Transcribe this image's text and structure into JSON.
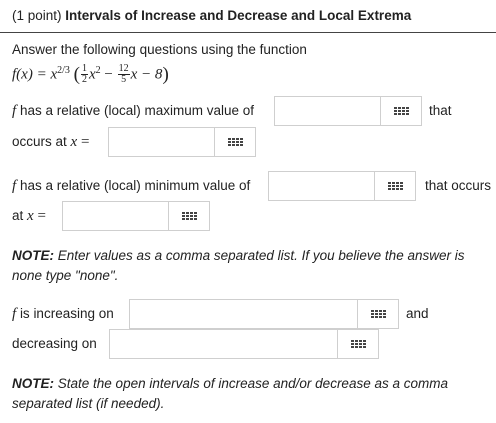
{
  "header": {
    "points": "(1 point)",
    "title": "Intervals of Increase and Decrease and Local Extrema"
  },
  "intro": {
    "text": "Answer the following questions using the function",
    "function_lhs": "f(x) = x",
    "exponent": "2/3",
    "frac1_num": "1",
    "frac1_den": "2",
    "x2": "x",
    "x2_exp": "2",
    "minus1": "−",
    "frac2_num": "12",
    "frac2_den": "5",
    "tail": "x − 8"
  },
  "q_max": {
    "f": "f",
    "prompt": "has a relative (local) maximum value of",
    "after": "that",
    "line2_prefix": "occurs at",
    "xvar": "x",
    "eq": "=",
    "value_answer": "",
    "location_answer": ""
  },
  "q_min": {
    "f": "f",
    "prompt": "has a relative (local) minimum value of",
    "after": "that occurs",
    "line2_prefix": "at",
    "xvar": "x",
    "eq": "=",
    "value_answer": "",
    "location_answer": ""
  },
  "note1": {
    "label": "NOTE:",
    "text": "Enter values as a comma separated list. If you believe the answer is",
    "text2": "none type \"none\"."
  },
  "q_intervals": {
    "f": "f",
    "increasing_label": "is increasing on",
    "and": "and",
    "decreasing_label": "decreasing on",
    "increasing_answer": "",
    "decreasing_answer": ""
  },
  "note2": {
    "label": "NOTE:",
    "text": "State the open intervals of increase and/or decrease as a comma",
    "text2": "separated list (if needed)."
  },
  "icons": {
    "equation_editor": "grid-keypad-icon"
  }
}
